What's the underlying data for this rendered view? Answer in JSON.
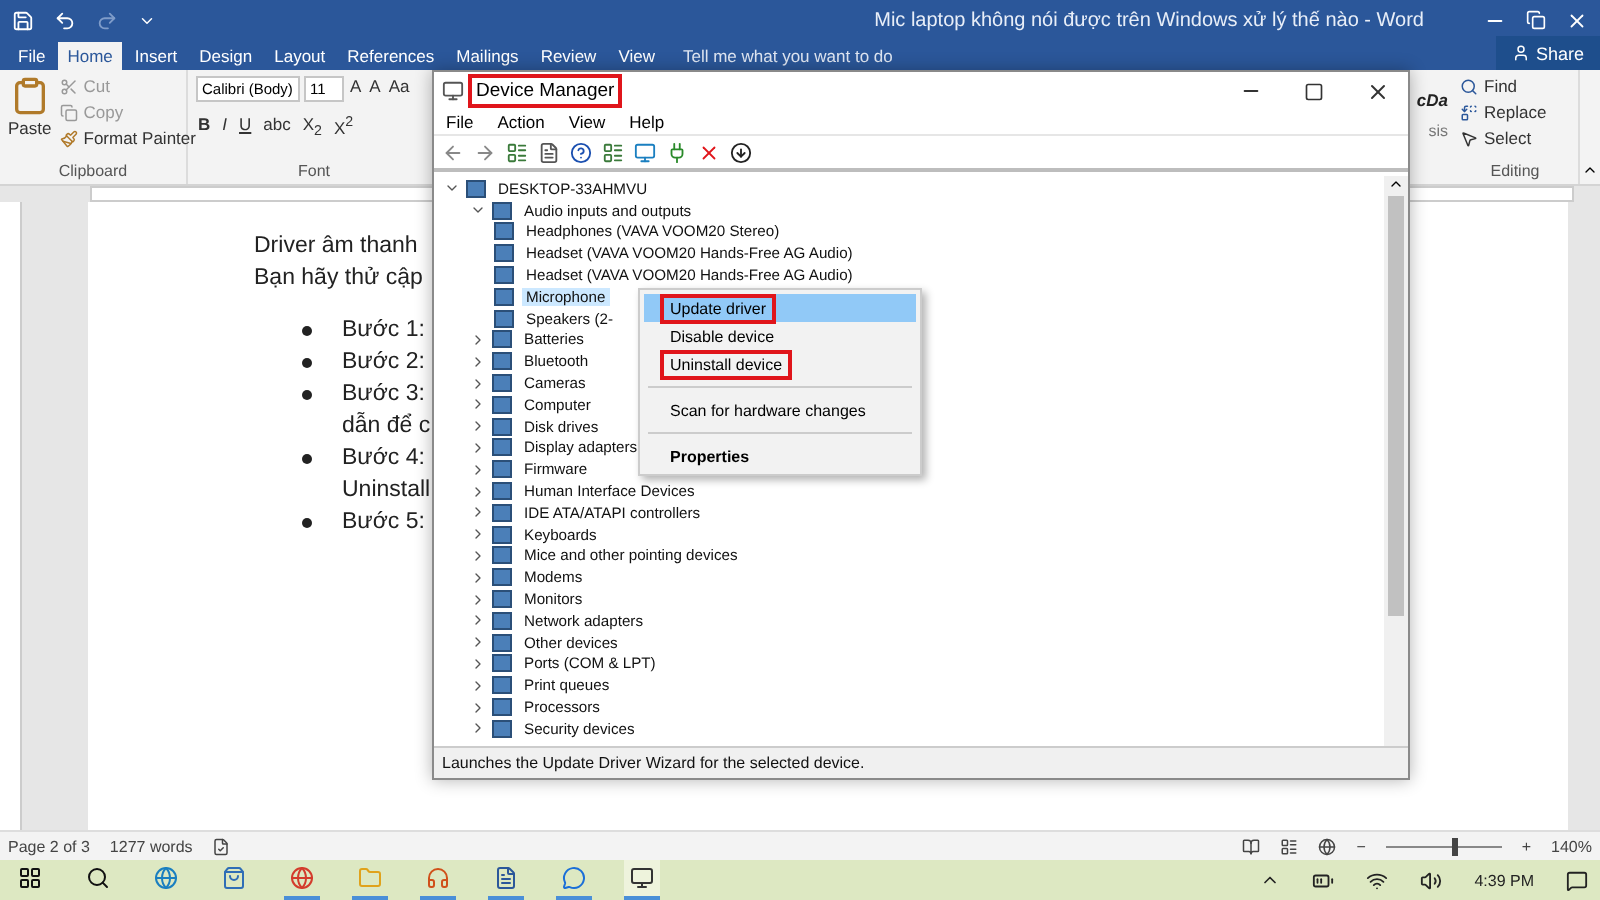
{
  "word": {
    "title": "Mic laptop không nói được trên Windows xử lý thế nào - Word",
    "tabs": [
      {
        "label": "File",
        "selected": false
      },
      {
        "label": "Home",
        "selected": true
      },
      {
        "label": "Insert",
        "selected": false
      },
      {
        "label": "Design",
        "selected": false
      },
      {
        "label": "Layout",
        "selected": false
      },
      {
        "label": "References",
        "selected": false
      },
      {
        "label": "Mailings",
        "selected": false
      },
      {
        "label": "Review",
        "selected": false
      },
      {
        "label": "View",
        "selected": false
      }
    ],
    "tell_me": "Tell me what you want to do",
    "share": "Share",
    "clipboard": {
      "paste": "Paste",
      "cut": "Cut",
      "copy": "Copy",
      "format_painter": "Format Painter",
      "label": "Clipboard"
    },
    "font": {
      "name": "Calibri (Body)",
      "size": "11",
      "grow": "A",
      "shrink": "A",
      "change_case": "Aa",
      "format_buttons": [
        "B",
        "I",
        "U",
        "abc",
        "X$_{2}$",
        "X$^{2}$"
      ],
      "label": "Font"
    },
    "styles": {
      "sample": "cDa",
      "caption": "sis"
    },
    "editing": {
      "find": "Find",
      "replace": "Replace",
      "select": "Select",
      "label": "Editing"
    },
    "document": {
      "paragraphs": [
        "Driver âm thanh",
        "Bạn hãy thử cập"
      ],
      "bullets": [
        {
          "lines": [
            "Bước 1:"
          ]
        },
        {
          "lines": [
            "Bước 2:"
          ]
        },
        {
          "lines": [
            "Bước 3:",
            "dẫn để c"
          ]
        },
        {
          "lines": [
            "Bước 4:",
            "Uninstall"
          ]
        },
        {
          "lines": [
            "Bước 5:"
          ]
        }
      ]
    },
    "status_bar": {
      "page": "Page 2 of 3",
      "words": "1277 words",
      "minus": "−",
      "plus": "+",
      "zoom_slider": {
        "level": 0.57
      },
      "zoom": "140%"
    }
  },
  "taskbar": {
    "time": "4:39 PM"
  },
  "device_manager": {
    "title": "Device Manager",
    "title_annotated": true,
    "menu": [
      "File",
      "Action",
      "View",
      "Help"
    ],
    "tree": [
      {
        "label": "DESKTOP-33AHMVU",
        "expanded": true,
        "children": [
          {
            "label": "Audio inputs and outputs",
            "expanded": true,
            "children": [
              {
                "label": "Headphones (VAVA VOOM20 Stereo)",
                "selected": false
              },
              {
                "label": "Headset (VAVA VOOM20 Hands-Free AG Audio)",
                "selected": false
              },
              {
                "label": "Headset (VAVA VOOM20 Hands-Free AG Audio)",
                "selected": false
              },
              {
                "label": "Microphone",
                "selected": true
              },
              {
                "label": "Speakers (2-",
                "selected": false
              }
            ]
          },
          {
            "label": "Batteries",
            "expanded": false
          },
          {
            "label": "Bluetooth",
            "expanded": false
          },
          {
            "label": "Cameras",
            "expanded": false
          },
          {
            "label": "Computer",
            "expanded": false
          },
          {
            "label": "Disk drives",
            "expanded": false
          },
          {
            "label": "Display adapters",
            "expanded": false
          },
          {
            "label": "Firmware",
            "expanded": false
          },
          {
            "label": "Human Interface Devices",
            "expanded": false
          },
          {
            "label": "IDE ATA/ATAPI controllers",
            "expanded": false
          },
          {
            "label": "Keyboards",
            "expanded": false
          },
          {
            "label": "Mice and other pointing devices",
            "expanded": false
          },
          {
            "label": "Modems",
            "expanded": false
          },
          {
            "label": "Monitors",
            "expanded": false
          },
          {
            "label": "Network adapters",
            "expanded": false
          },
          {
            "label": "Other devices",
            "expanded": false
          },
          {
            "label": "Ports (COM & LPT)",
            "expanded": false
          },
          {
            "label": "Print queues",
            "expanded": false
          },
          {
            "label": "Processors",
            "expanded": false
          },
          {
            "label": "Security devices",
            "expanded": false
          }
        ]
      }
    ],
    "context_menu": [
      {
        "kind": "item",
        "label": "Update driver",
        "selected": true,
        "annotated": true
      },
      {
        "kind": "item",
        "label": "Disable device",
        "selected": false,
        "annotated": false
      },
      {
        "kind": "item",
        "label": "Uninstall device",
        "selected": false,
        "annotated": true
      },
      {
        "kind": "separator"
      },
      {
        "kind": "item",
        "label": "Scan for hardware changes",
        "selected": false,
        "annotated": false
      },
      {
        "kind": "separator"
      },
      {
        "kind": "default",
        "label": "Properties",
        "selected": false,
        "annotated": false
      }
    ],
    "status": "Launches the Update Driver Wizard for the selected device."
  }
}
